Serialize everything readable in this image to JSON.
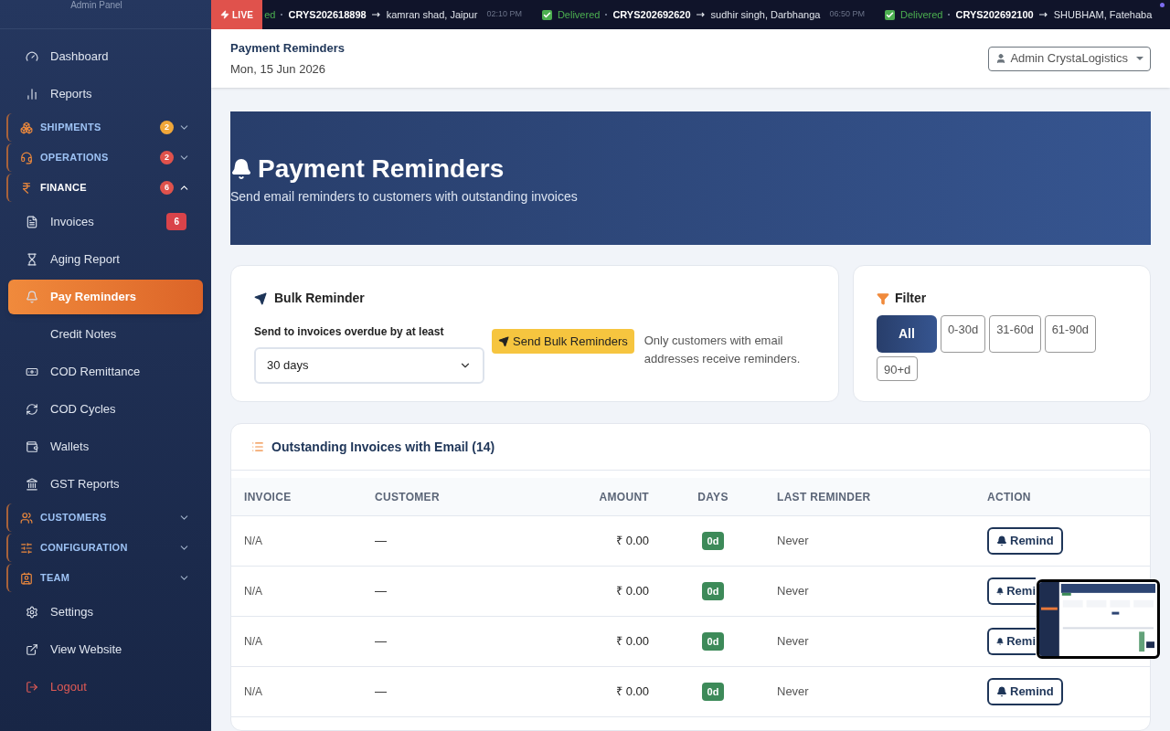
{
  "sidebar": {
    "brand_subtitle": "Admin Panel",
    "items": [
      {
        "kind": "link",
        "label": "Dashboard",
        "selected": false
      },
      {
        "kind": "link",
        "label": "Reports",
        "selected": false
      },
      {
        "kind": "group",
        "label": "SHIPMENTS",
        "badge": "2",
        "color": "#f0a73a",
        "expanded": false
      },
      {
        "kind": "group",
        "label": "OPERATIONS",
        "badge": "2",
        "color": "#e0524c",
        "expanded": false
      },
      {
        "kind": "group",
        "label": "FINANCE",
        "badge": "6",
        "color": "#e0524c",
        "expanded": true
      },
      {
        "kind": "link",
        "label": "Invoices",
        "selected": false,
        "badge": "6"
      },
      {
        "kind": "link",
        "label": "Aging Report",
        "selected": false
      },
      {
        "kind": "link",
        "label": "Pay Reminders",
        "selected": true
      },
      {
        "kind": "link",
        "label": "Credit Notes",
        "selected": false
      },
      {
        "kind": "link",
        "label": "COD Remittance",
        "selected": false
      },
      {
        "kind": "link",
        "label": "COD Cycles",
        "selected": false
      },
      {
        "kind": "link",
        "label": "Wallets",
        "selected": false
      },
      {
        "kind": "link",
        "label": "GST Reports",
        "selected": false
      },
      {
        "kind": "group",
        "label": "CUSTOMERS",
        "expanded": false
      },
      {
        "kind": "group",
        "label": "CONFIGURATION",
        "expanded": false
      },
      {
        "kind": "group",
        "label": "TEAM",
        "expanded": false
      },
      {
        "kind": "link",
        "label": "Settings",
        "selected": false
      },
      {
        "kind": "link",
        "label": "View Website",
        "selected": false
      },
      {
        "kind": "logout",
        "label": "Logout",
        "selected": false
      }
    ]
  },
  "ticker": {
    "badge": "LIVE",
    "items": [
      {
        "status": "ed",
        "awb": "CRYS202618898",
        "dest": "kamran shad, Jaipur",
        "time": "02:10 PM"
      },
      {
        "status": "Delivered",
        "awb": "CRYS202692620",
        "dest": "sudhir singh, Darbhanga",
        "time": "06:50 PM"
      },
      {
        "status": "Delivered",
        "awb": "CRYS202692100",
        "dest": "SHUBHAM, Fatehaba"
      }
    ]
  },
  "header": {
    "title": "Payment Reminders",
    "date": "Mon, 15 Jun 2026",
    "user": "Admin CrystaLogistics"
  },
  "banner": {
    "title": "Payment Reminders",
    "subtitle": "Send email reminders to customers with outstanding invoices"
  },
  "bulk": {
    "title": "Bulk Reminder",
    "label": "Send to invoices overdue by at least",
    "value": "30 days",
    "button": "Send Bulk Reminders",
    "note": "Only customers with email addresses receive reminders."
  },
  "filter": {
    "title": "Filter",
    "options": [
      {
        "label": "All",
        "selected": true
      },
      {
        "label": "0-30d",
        "selected": false
      },
      {
        "label": "31-60d",
        "selected": false
      },
      {
        "label": "61-90d",
        "selected": false
      },
      {
        "label": "90+d",
        "selected": false
      }
    ]
  },
  "table": {
    "title": "Outstanding Invoices with Email (14)",
    "columns": [
      "INVOICE",
      "CUSTOMER",
      "AMOUNT",
      "DAYS",
      "LAST REMINDER",
      "ACTION"
    ],
    "rows": [
      {
        "invoice": "N/A",
        "customer": "—",
        "amount": "₹ 0.00",
        "days": "0d",
        "last_reminder": "Never",
        "action": "Remind",
        "covered": false
      },
      {
        "invoice": "N/A",
        "customer": "—",
        "amount": "₹ 0.00",
        "days": "0d",
        "last_reminder": "Never",
        "action": "Remi",
        "covered": true
      },
      {
        "invoice": "N/A",
        "customer": "—",
        "amount": "₹ 0.00",
        "days": "0d",
        "last_reminder": "Never",
        "action": "Remi",
        "covered": true
      },
      {
        "invoice": "N/A",
        "customer": "—",
        "amount": "₹ 0.00",
        "days": "0d",
        "last_reminder": "Never",
        "action": "Remind",
        "covered": false
      }
    ]
  }
}
